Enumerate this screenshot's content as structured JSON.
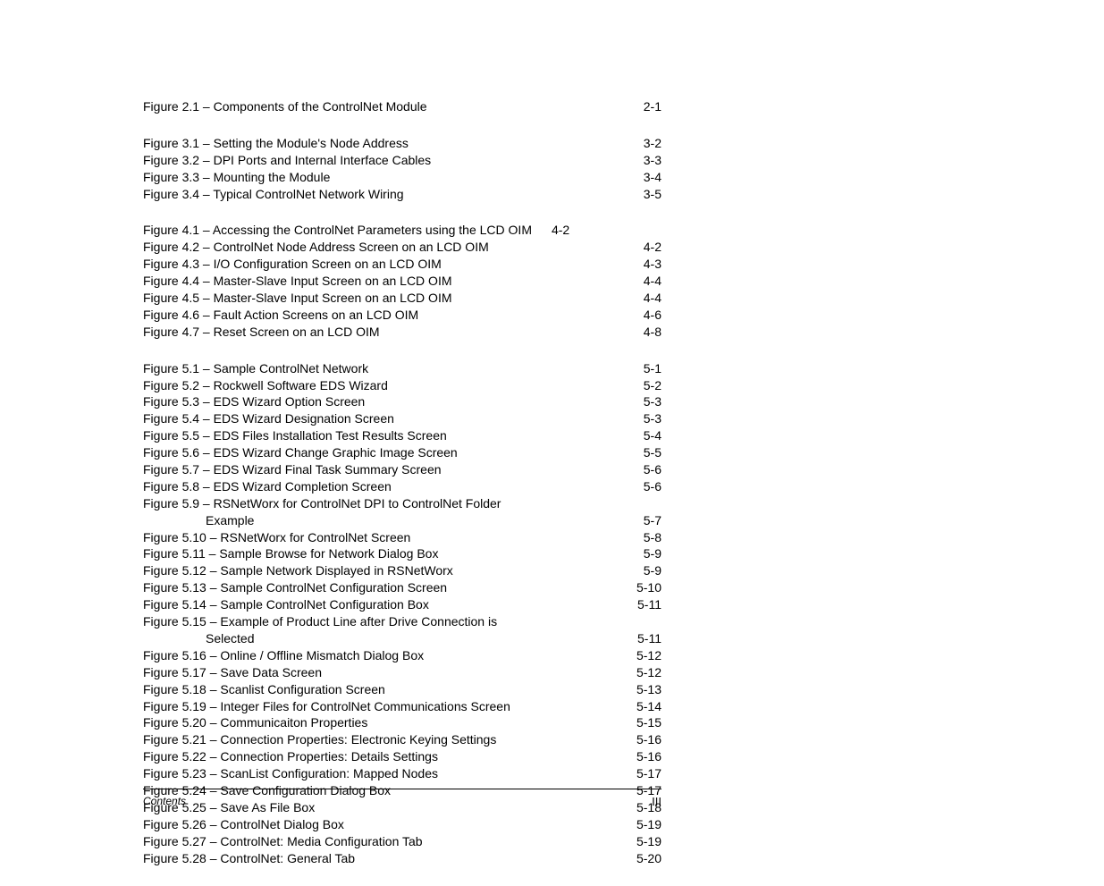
{
  "sections": [
    {
      "entries": [
        {
          "label": "Figure 2.1 – Components of the ControlNet Module",
          "page": "2-1"
        }
      ]
    },
    {
      "entries": [
        {
          "label": "Figure 3.1 – Setting the Module's Node Address",
          "page": "3-2"
        },
        {
          "label": "Figure 3.2 – DPI Ports and Internal Interface Cables",
          "page": "3-3"
        },
        {
          "label": "Figure 3.3 – Mounting the Module",
          "page": "3-4"
        },
        {
          "label": "Figure 3.4 – Typical ControlNet Network Wiring",
          "page": "3-5"
        }
      ]
    },
    {
      "entries": [
        {
          "label": "Figure 4.1 – Accessing the ControlNet Parameters using the LCD OIM",
          "page": "4-2",
          "noleader": true
        },
        {
          "label": "Figure 4.2 – ControlNet Node Address Screen on an LCD OIM",
          "page": "4-2"
        },
        {
          "label": "Figure 4.3 – I/O Configuration Screen on an LCD OIM",
          "page": "4-3"
        },
        {
          "label": "Figure 4.4 – Master-Slave Input Screen on an LCD OIM",
          "page": "4-4"
        },
        {
          "label": "Figure 4.5 – Master-Slave Input Screen on an LCD OIM",
          "page": "4-4"
        },
        {
          "label": "Figure 4.6 – Fault Action Screens on an LCD OIM",
          "page": "4-6"
        },
        {
          "label": "Figure 4.7 – Reset Screen on an LCD OIM",
          "page": "4-8"
        }
      ]
    },
    {
      "entries": [
        {
          "label": "Figure 5.1 – Sample ControlNet Network",
          "page": "5-1"
        },
        {
          "label": "Figure 5.2 – Rockwell Software EDS Wizard",
          "page": "5-2"
        },
        {
          "label": "Figure 5.3 – EDS Wizard Option Screen",
          "page": "5-3"
        },
        {
          "label": "Figure 5.4 – EDS Wizard Designation Screen",
          "page": "5-3"
        },
        {
          "label": "Figure 5.5 – EDS Files Installation Test Results Screen",
          "page": "5-4"
        },
        {
          "label": "Figure 5.6 – EDS Wizard Change Graphic Image Screen",
          "page": "5-5"
        },
        {
          "label": "Figure 5.7 – EDS Wizard Final Task Summary Screen",
          "page": "5-6"
        },
        {
          "label": "Figure 5.8 – EDS Wizard Completion Screen",
          "page": "5-6"
        },
        {
          "label": "Figure 5.9 – RSNetWorx for ControlNet DPI to ControlNet Folder",
          "nopage": true
        },
        {
          "label": "Example",
          "page": "5-7",
          "sub": true
        },
        {
          "label": "Figure 5.10 – RSNetWorx for ControlNet Screen",
          "page": "5-8"
        },
        {
          "label": "Figure 5.11 – Sample Browse for Network Dialog Box",
          "page": "5-9"
        },
        {
          "label": "Figure 5.12 – Sample Network Displayed in RSNetWorx",
          "page": "5-9"
        },
        {
          "label": "Figure 5.13 – Sample ControlNet Configuration Screen",
          "page": "5-10"
        },
        {
          "label": "Figure 5.14 – Sample ControlNet Configuration Box",
          "page": "5-11"
        },
        {
          "label": "Figure 5.15 – Example of Product Line after Drive Connection is",
          "nopage": true
        },
        {
          "label": "Selected",
          "page": "5-11",
          "sub": true
        },
        {
          "label": "Figure 5.16 – Online / Offline Mismatch Dialog Box",
          "page": "5-12"
        },
        {
          "label": "Figure 5.17 –  Save Data Screen",
          "page": "5-12"
        },
        {
          "label": "Figure 5.18 – Scanlist Configuration  Screen",
          "page": "5-13"
        },
        {
          "label": "Figure 5.19 – Integer Files for ControlNet Communications Screen",
          "page": "5-14"
        },
        {
          "label": "Figure 5.20 – Communicaiton Properties",
          "page": "5-15"
        },
        {
          "label": "Figure 5.21 – Connection Properties: Electronic Keying Settings",
          "page": "5-16"
        },
        {
          "label": "Figure 5.22 – Connection Properties: Details Settings",
          "page": "5-16"
        },
        {
          "label": "Figure 5.23 – ScanList Configuration: Mapped Nodes",
          "page": "5-17"
        },
        {
          "label": "Figure 5.24 – Save Configuration Dialog Box",
          "page": "5-17"
        },
        {
          "label": "Figure 5.25 – Save As File Box",
          "page": "5-18"
        },
        {
          "label": "Figure 5.26 – ControlNet Dialog Box",
          "page": "5-19"
        },
        {
          "label": "Figure 5.27 – ControlNet: Media Configuration Tab",
          "page": "5-19"
        },
        {
          "label": "Figure 5.28 – ControlNet: General Tab",
          "page": "5-20"
        }
      ]
    }
  ],
  "footer": {
    "left": "Contents",
    "right": "III"
  }
}
